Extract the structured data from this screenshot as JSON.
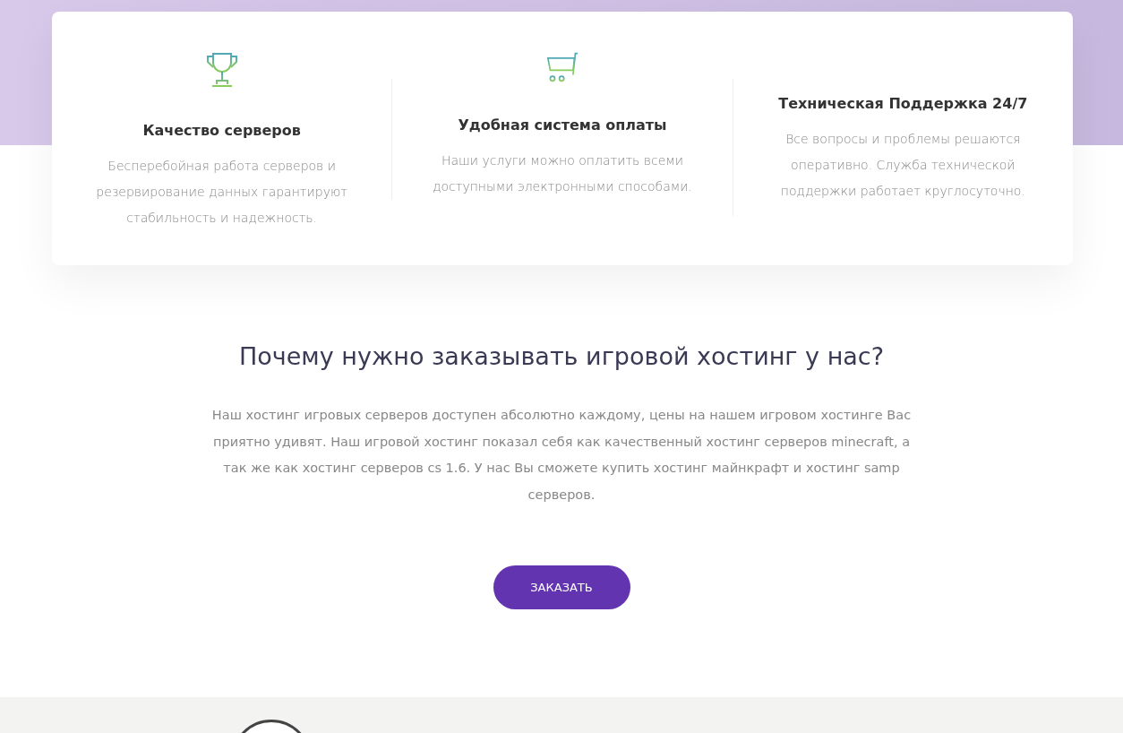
{
  "features": [
    {
      "kind": "trophy",
      "title": "Качество серверов",
      "text": "Бесперебойная работа серверов и резервирование данных гарантируют стабильность и надежность."
    },
    {
      "kind": "cart",
      "title": "Удобная система оплаты",
      "text": "Наши услуги можно оплатить всеми доступными электронными способами."
    },
    {
      "kind": "plain",
      "title": "Техническая Поддержка 24/7",
      "text": "Все вопросы и проблемы решаются оперативно. Служба технической поддержки работает круглосуточно."
    }
  ],
  "why": {
    "title": "Почему нужно заказывать игровой хостинг у нас?",
    "text": "Наш хостинг игровых серверов доступен абсолютно каждому, цены на нашем игровом хостинге Вас приятно удивят. Наш игровой хостинг показал себя как качественный хостинг серверов minecraft, а так же как хостинг серверов cs 1.6. У нас Вы сможете купить хостинг майнкрафт и хостинг samp серверов.",
    "button": "ЗАКАЗАТЬ"
  }
}
